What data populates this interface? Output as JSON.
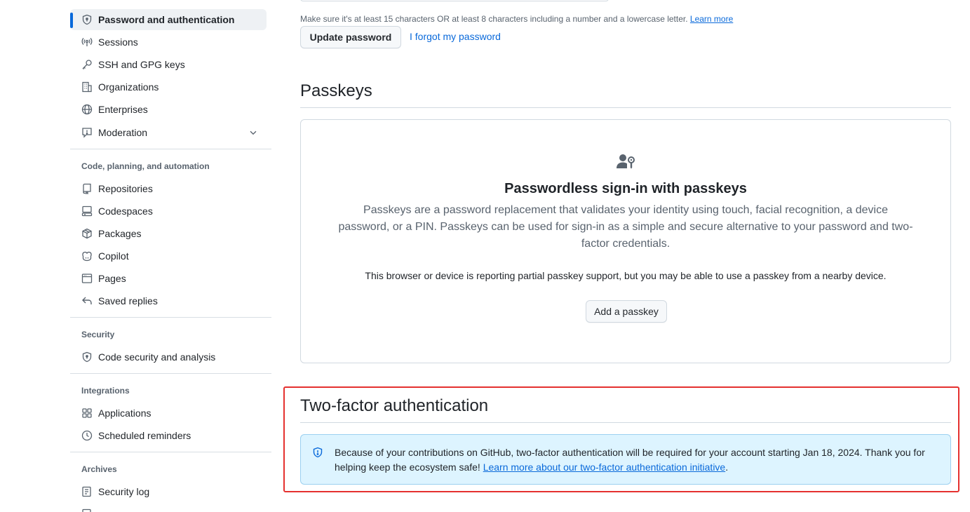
{
  "sidebar": {
    "items_top": [
      {
        "label": "Password and authentication",
        "icon": "shield-lock-icon",
        "active": true
      },
      {
        "label": "Sessions",
        "icon": "broadcast-icon"
      },
      {
        "label": "SSH and GPG keys",
        "icon": "key-icon"
      },
      {
        "label": "Organizations",
        "icon": "organization-icon"
      },
      {
        "label": "Enterprises",
        "icon": "globe-icon"
      },
      {
        "label": "Moderation",
        "icon": "report-icon",
        "expandable": true
      }
    ],
    "section_code": {
      "heading": "Code, planning, and automation",
      "items": [
        {
          "label": "Repositories",
          "icon": "repo-icon"
        },
        {
          "label": "Codespaces",
          "icon": "codespaces-icon"
        },
        {
          "label": "Packages",
          "icon": "package-icon"
        },
        {
          "label": "Copilot",
          "icon": "copilot-icon"
        },
        {
          "label": "Pages",
          "icon": "browser-icon"
        },
        {
          "label": "Saved replies",
          "icon": "reply-icon"
        }
      ]
    },
    "section_security": {
      "heading": "Security",
      "items": [
        {
          "label": "Code security and analysis",
          "icon": "shield-lock-icon"
        }
      ]
    },
    "section_integrations": {
      "heading": "Integrations",
      "items": [
        {
          "label": "Applications",
          "icon": "apps-icon"
        },
        {
          "label": "Scheduled reminders",
          "icon": "clock-icon"
        }
      ]
    },
    "section_archives": {
      "heading": "Archives",
      "items": [
        {
          "label": "Security log",
          "icon": "log-icon"
        }
      ]
    }
  },
  "password": {
    "hint": "Make sure it's at least 15 characters OR at least 8 characters including a number and a lowercase letter.",
    "hint_link": "Learn more",
    "update_button": "Update password",
    "forgot_link": "I forgot my password"
  },
  "passkeys": {
    "heading": "Passkeys",
    "title": "Passwordless sign-in with passkeys",
    "description": "Passkeys are a password replacement that validates your identity using touch, facial recognition, a device password, or a PIN. Passkeys can be used for sign-in as a simple and secure alternative to your password and two-factor credentials.",
    "note": "This browser or device is reporting partial passkey support, but you may be able to use a passkey from a nearby device.",
    "add_button": "Add a passkey"
  },
  "two_factor": {
    "heading": "Two-factor authentication",
    "flash_text": "Because of your contributions on GitHub, two-factor authentication will be required for your account starting Jan 18, 2024. Thank you for helping keep the ecosystem safe!",
    "flash_link": "Learn more about our two-factor authentication initiative",
    "flash_end": "."
  },
  "colors": {
    "accent": "#0969da",
    "highlight_border": "#e5312f",
    "flash_bg": "#ddf4ff"
  }
}
